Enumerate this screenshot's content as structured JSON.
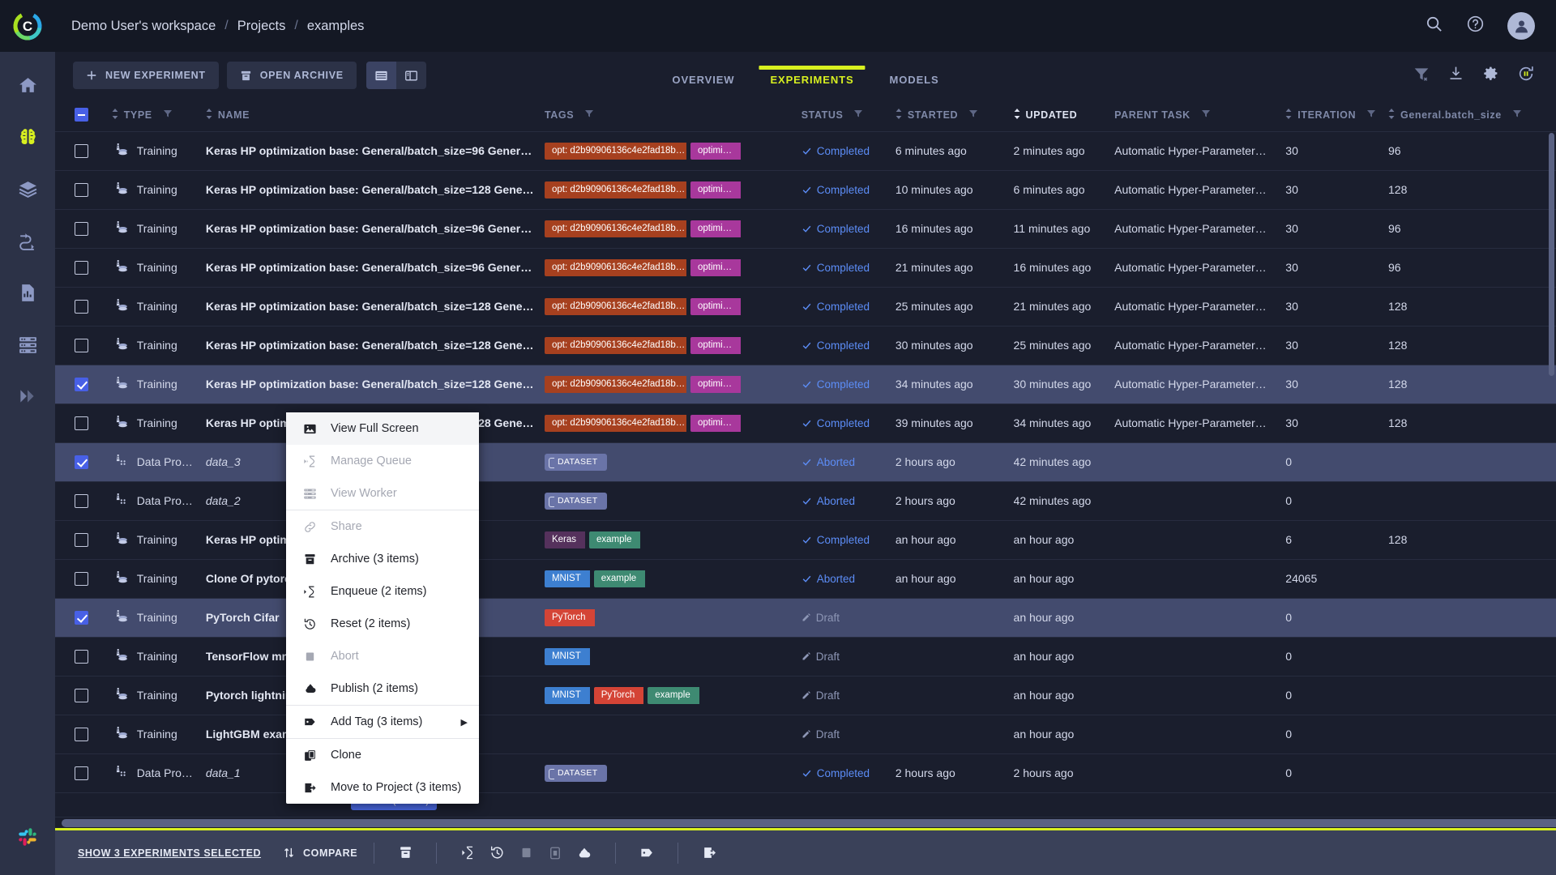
{
  "app": {
    "logo_icon": "clearml-logo-icon"
  },
  "sidebar": {
    "items": [
      {
        "name": "home",
        "icon": "home-icon",
        "active": false
      },
      {
        "name": "projects",
        "icon": "brain-icon",
        "active": true
      },
      {
        "name": "datasets",
        "icon": "layers-icon",
        "active": false
      },
      {
        "name": "pipelines",
        "icon": "pipeline-icon",
        "active": false
      },
      {
        "name": "reports",
        "icon": "report-icon",
        "active": false
      },
      {
        "name": "workers",
        "icon": "server-icon",
        "active": false
      },
      {
        "name": "expand",
        "icon": "double-chevron-right-icon",
        "active": false
      }
    ],
    "bottom": {
      "name": "slack",
      "icon": "slack-icon"
    }
  },
  "topbar": {
    "breadcrumb": [
      "Demo User's workspace",
      "Projects",
      "examples"
    ],
    "separator": "/",
    "icons": [
      "search-icon",
      "help-icon",
      "avatar-icon"
    ]
  },
  "toolbar": {
    "new_experiment_label": "NEW EXPERIMENT",
    "open_archive_label": "OPEN ARCHIVE",
    "view_table_icon": "table-view-icon",
    "view_split_icon": "split-view-icon",
    "tabs": [
      {
        "label": "OVERVIEW",
        "active": false
      },
      {
        "label": "EXPERIMENTS",
        "active": true
      },
      {
        "label": "MODELS",
        "active": false
      }
    ],
    "right_icons": [
      "filter-clear-icon",
      "download-icon",
      "gear-icon",
      "autorefresh-icon"
    ],
    "accent_color": "#d8f020"
  },
  "table": {
    "columns": [
      {
        "key": "check",
        "label": ""
      },
      {
        "key": "type",
        "label": "TYPE",
        "sortable": true,
        "filterable": true
      },
      {
        "key": "name",
        "label": "NAME",
        "sortable": true,
        "filterable": false
      },
      {
        "key": "tags",
        "label": "TAGS",
        "sortable": false,
        "filterable": true
      },
      {
        "key": "status",
        "label": "STATUS",
        "sortable": false,
        "filterable": true
      },
      {
        "key": "started",
        "label": "STARTED",
        "sortable": true,
        "filterable": true
      },
      {
        "key": "updated",
        "label": "UPDATED",
        "sortable": true,
        "filterable": false,
        "active_sort": true
      },
      {
        "key": "parent",
        "label": "PARENT TASK",
        "sortable": false,
        "filterable": true
      },
      {
        "key": "iteration",
        "label": "ITERATION",
        "sortable": true,
        "filterable": true
      },
      {
        "key": "batch",
        "label": "General.batch_size",
        "sortable": true,
        "filterable": true
      }
    ],
    "header_checkbox_state": "partial",
    "rows": [
      {
        "selected": false,
        "type": "Training",
        "type_icon": "training-icon",
        "name": "Keras HP optimization base: General/batch_size=96 Gener…",
        "tags": [
          {
            "text": "opt: d2b90906136c4e2fad18b…",
            "color": "#a6401f"
          },
          {
            "text": "optimi…",
            "color": "#a8389c"
          }
        ],
        "status": "Completed",
        "status_kind": "completed",
        "started": "6 minutes ago",
        "updated": "2 minutes ago",
        "parent": "Automatic Hyper-Parameter…",
        "iteration": "30",
        "batch": "96"
      },
      {
        "selected": false,
        "type": "Training",
        "type_icon": "training-icon",
        "name": "Keras HP optimization base: General/batch_size=128 Gene…",
        "tags": [
          {
            "text": "opt: d2b90906136c4e2fad18b…",
            "color": "#a6401f"
          },
          {
            "text": "optimi…",
            "color": "#a8389c"
          }
        ],
        "status": "Completed",
        "status_kind": "completed",
        "started": "10 minutes ago",
        "updated": "6 minutes ago",
        "parent": "Automatic Hyper-Parameter…",
        "iteration": "30",
        "batch": "128"
      },
      {
        "selected": false,
        "type": "Training",
        "type_icon": "training-icon",
        "name": "Keras HP optimization base: General/batch_size=96 Gener…",
        "tags": [
          {
            "text": "opt: d2b90906136c4e2fad18b…",
            "color": "#a6401f"
          },
          {
            "text": "optimi…",
            "color": "#a8389c"
          }
        ],
        "status": "Completed",
        "status_kind": "completed",
        "started": "16 minutes ago",
        "updated": "11 minutes ago",
        "parent": "Automatic Hyper-Parameter…",
        "iteration": "30",
        "batch": "96"
      },
      {
        "selected": false,
        "type": "Training",
        "type_icon": "training-icon",
        "name": "Keras HP optimization base: General/batch_size=96 Gener…",
        "tags": [
          {
            "text": "opt: d2b90906136c4e2fad18b…",
            "color": "#a6401f"
          },
          {
            "text": "optimi…",
            "color": "#a8389c"
          }
        ],
        "status": "Completed",
        "status_kind": "completed",
        "started": "21 minutes ago",
        "updated": "16 minutes ago",
        "parent": "Automatic Hyper-Parameter…",
        "iteration": "30",
        "batch": "96"
      },
      {
        "selected": false,
        "type": "Training",
        "type_icon": "training-icon",
        "name": "Keras HP optimization base: General/batch_size=128 Gene…",
        "tags": [
          {
            "text": "opt: d2b90906136c4e2fad18b…",
            "color": "#a6401f"
          },
          {
            "text": "optimi…",
            "color": "#a8389c"
          }
        ],
        "status": "Completed",
        "status_kind": "completed",
        "started": "25 minutes ago",
        "updated": "21 minutes ago",
        "parent": "Automatic Hyper-Parameter…",
        "iteration": "30",
        "batch": "128"
      },
      {
        "selected": false,
        "type": "Training",
        "type_icon": "training-icon",
        "name": "Keras HP optimization base: General/batch_size=128 Gene…",
        "tags": [
          {
            "text": "opt: d2b90906136c4e2fad18b…",
            "color": "#a6401f"
          },
          {
            "text": "optimi…",
            "color": "#a8389c"
          }
        ],
        "status": "Completed",
        "status_kind": "completed",
        "started": "30 minutes ago",
        "updated": "25 minutes ago",
        "parent": "Automatic Hyper-Parameter…",
        "iteration": "30",
        "batch": "128"
      },
      {
        "selected": true,
        "type": "Training",
        "type_icon": "training-icon",
        "name": "Keras HP optimization base: General/batch_size=128 Gene…",
        "tags": [
          {
            "text": "opt: d2b90906136c4e2fad18b…",
            "color": "#a6401f"
          },
          {
            "text": "optimi…",
            "color": "#a8389c"
          }
        ],
        "status": "Completed",
        "status_kind": "completed",
        "started": "34 minutes ago",
        "updated": "30 minutes ago",
        "parent": "Automatic Hyper-Parameter…",
        "iteration": "30",
        "batch": "128"
      },
      {
        "selected": false,
        "type": "Training",
        "type_icon": "training-icon",
        "name": "Keras HP optimization base: General/batch_size=128 Gene…",
        "tags": [
          {
            "text": "opt: d2b90906136c4e2fad18b…",
            "color": "#a6401f"
          },
          {
            "text": "optimi…",
            "color": "#a8389c"
          }
        ],
        "status": "Completed",
        "status_kind": "completed",
        "started": "39 minutes ago",
        "updated": "34 minutes ago",
        "parent": "Automatic Hyper-Parameter…",
        "iteration": "30",
        "batch": "128"
      },
      {
        "selected": true,
        "type": "Data Pro…",
        "type_icon": "dataprocessing-icon",
        "name": "data_3",
        "name_italic": true,
        "tags": [
          {
            "text": "DATASET",
            "color": "#6a74a8",
            "dataset": true
          }
        ],
        "status": "Aborted",
        "status_kind": "aborted",
        "started": "2 hours ago",
        "updated": "42 minutes ago",
        "parent": "",
        "iteration": "0",
        "batch": ""
      },
      {
        "selected": false,
        "type": "Data Pro…",
        "type_icon": "dataprocessing-icon",
        "name": "data_2",
        "name_italic": true,
        "tags": [
          {
            "text": "DATASET",
            "color": "#6a74a8",
            "dataset": true
          }
        ],
        "status": "Aborted",
        "status_kind": "aborted",
        "started": "2 hours ago",
        "updated": "42 minutes ago",
        "parent": "",
        "iteration": "0",
        "batch": ""
      },
      {
        "selected": false,
        "type": "Training",
        "type_icon": "training-icon",
        "name": "Keras HP optimi…",
        "tags": [
          {
            "text": "Keras",
            "color": "#55315c"
          },
          {
            "text": "example",
            "color": "#3e8a72"
          }
        ],
        "status": "Completed",
        "status_kind": "completed",
        "started": "an hour ago",
        "updated": "an hour ago",
        "parent": "",
        "iteration": "6",
        "batch": "128"
      },
      {
        "selected": false,
        "type": "Training",
        "type_icon": "training-icon",
        "name": "Clone Of pytorch…",
        "tags": [
          {
            "text": "MNIST",
            "color": "#3d7fd0"
          },
          {
            "text": "example",
            "color": "#3e8a72"
          }
        ],
        "status": "Aborted",
        "status_kind": "aborted",
        "started": "an hour ago",
        "updated": "an hour ago",
        "parent": "",
        "iteration": "24065",
        "batch": ""
      },
      {
        "selected": true,
        "type": "Training",
        "type_icon": "training-icon",
        "name": "PyTorch Cifar",
        "tags": [
          {
            "text": "PyTorch",
            "color": "#d44436"
          }
        ],
        "status": "Draft",
        "status_kind": "draft",
        "started": "",
        "updated": "an hour ago",
        "parent": "",
        "iteration": "0",
        "batch": ""
      },
      {
        "selected": false,
        "type": "Training",
        "type_icon": "training-icon",
        "name": "TensorFlow mni…",
        "tags": [
          {
            "text": "MNIST",
            "color": "#3d7fd0"
          }
        ],
        "status": "Draft",
        "status_kind": "draft",
        "started": "",
        "updated": "an hour ago",
        "parent": "",
        "iteration": "0",
        "batch": ""
      },
      {
        "selected": false,
        "type": "Training",
        "type_icon": "training-icon",
        "name": "Pytorch lightning…",
        "tags": [
          {
            "text": "MNIST",
            "color": "#3d7fd0"
          },
          {
            "text": "PyTorch",
            "color": "#d44436"
          },
          {
            "text": "example",
            "color": "#3e8a72"
          }
        ],
        "status": "Draft",
        "status_kind": "draft",
        "started": "",
        "updated": "an hour ago",
        "parent": "",
        "iteration": "0",
        "batch": ""
      },
      {
        "selected": false,
        "type": "Training",
        "type_icon": "training-icon",
        "name": "LightGBM exam…",
        "tags": [],
        "status": "Draft",
        "status_kind": "draft",
        "started": "",
        "updated": "an hour ago",
        "parent": "",
        "iteration": "0",
        "batch": ""
      },
      {
        "selected": false,
        "type": "Data Pro…",
        "type_icon": "dataprocessing-icon",
        "name": "data_1",
        "name_italic": true,
        "tags": [
          {
            "text": "DATASET",
            "color": "#6a74a8",
            "dataset": true
          }
        ],
        "status": "Completed",
        "status_kind": "completed",
        "started": "2 hours ago",
        "updated": "2 hours ago",
        "parent": "",
        "iteration": "0",
        "batch": ""
      }
    ]
  },
  "context_menu": {
    "items": [
      {
        "label": "View Full Screen",
        "icon": "fullscreen-icon",
        "disabled": false,
        "highlighted": true
      },
      {
        "label": "Manage Queue",
        "icon": "queue-icon",
        "disabled": true
      },
      {
        "label": "View Worker",
        "icon": "worker-icon",
        "disabled": true
      },
      {
        "separator": true
      },
      {
        "label": "Share",
        "icon": "link-icon",
        "disabled": true
      },
      {
        "label": "Archive (3 items)",
        "icon": "archive-icon",
        "disabled": false
      },
      {
        "label": "Enqueue (2 items)",
        "icon": "enqueue-icon",
        "disabled": false
      },
      {
        "label": "Reset (2 items)",
        "icon": "reset-icon",
        "disabled": false
      },
      {
        "label": "Abort",
        "icon": "abort-icon",
        "disabled": true
      },
      {
        "label": "Publish (2 items)",
        "icon": "publish-icon",
        "disabled": false
      },
      {
        "separator": true
      },
      {
        "label": "Add Tag (3 items)",
        "icon": "tag-icon",
        "disabled": false,
        "submenu": true,
        "arrow": "▶"
      },
      {
        "separator": true
      },
      {
        "label": "Clone",
        "icon": "clone-icon",
        "disabled": false
      },
      {
        "label": "Move to Project (3 items)",
        "icon": "move-icon",
        "disabled": false
      }
    ]
  },
  "bottombar": {
    "selected_label": "SHOW 3 EXPERIMENTS SELECTED",
    "compare_label": "COMPARE",
    "tooltip": "Archive (3 items)",
    "actions": [
      {
        "name": "archive",
        "icon": "archive-icon",
        "disabled": false
      },
      {
        "name": "enqueue",
        "icon": "enqueue-icon",
        "disabled": false
      },
      {
        "name": "reset",
        "icon": "reset-icon",
        "disabled": false
      },
      {
        "name": "abort",
        "icon": "abort-icon",
        "disabled": true
      },
      {
        "name": "abort-all",
        "icon": "abort-all-icon",
        "disabled": true
      },
      {
        "name": "publish",
        "icon": "publish-icon",
        "disabled": false
      },
      {
        "name": "add-tag",
        "icon": "tag-icon",
        "disabled": false
      },
      {
        "name": "move-to-project",
        "icon": "move-icon",
        "disabled": false
      }
    ]
  }
}
